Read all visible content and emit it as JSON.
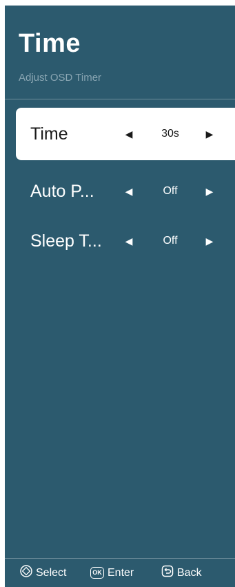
{
  "header": {
    "title": "Time",
    "subtitle": "Adjust OSD Timer"
  },
  "settings": [
    {
      "label": "Time",
      "value": "30s",
      "selected": true
    },
    {
      "label": "Auto P...",
      "value": "Off",
      "selected": false
    },
    {
      "label": "Sleep T...",
      "value": "Off",
      "selected": false
    }
  ],
  "footer": {
    "select_label": "Select",
    "enter_label": "Enter",
    "back_label": "Back",
    "ok_icon_text": "OK"
  },
  "colors": {
    "panel_background": "#2c5a6e",
    "subtitle": "#8aa6b3",
    "selected_row": "#ffffff"
  },
  "icons": {
    "left": "triangle-left",
    "right": "triangle-right",
    "select": "dpad-diamond",
    "enter": "ok-button",
    "back": "back-arrow"
  }
}
